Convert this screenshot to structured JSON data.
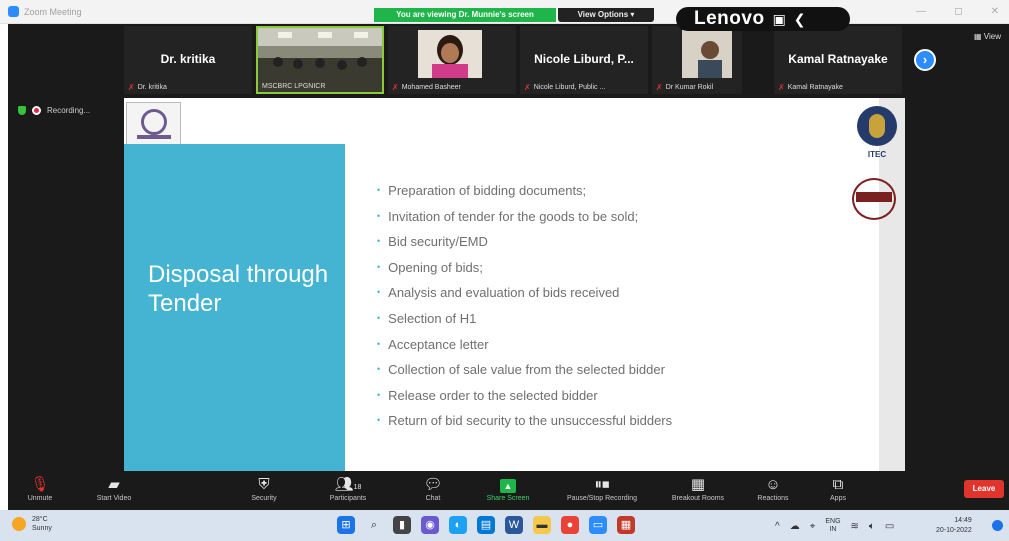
{
  "window": {
    "app_title": "Zoom Meeting",
    "viewing_banner": "You are viewing Dr. Munnie's screen",
    "view_options": "View Options",
    "lenovo_brand": "Lenovo",
    "view_button": "View"
  },
  "participants": [
    {
      "display_name": "Dr. kritika",
      "tag": "Dr. kritika",
      "has_video": false
    },
    {
      "display_name": "",
      "tag": "MSCBRC LPGNICR",
      "has_video": true,
      "active": true
    },
    {
      "display_name": "",
      "tag": "Mohamed Basheer",
      "has_video": true
    },
    {
      "display_name": "Nicole Liburd, P...",
      "tag": "Nicole Liburd, Public ...",
      "has_video": false
    },
    {
      "display_name": "",
      "tag": "Dr Kumar Rokil",
      "has_video": true
    },
    {
      "display_name": "Kamal Ratnayake",
      "tag": "Kamal Ratnayake",
      "has_video": false
    }
  ],
  "recording_label": "Recording...",
  "slide": {
    "title": "Disposal through Tender",
    "right_logo_text": "ITEC",
    "bullets": [
      "Preparation of bidding documents;",
      "Invitation of tender for the goods to be sold;",
      "Bid security/EMD",
      "Opening of bids;",
      "Analysis and evaluation of bids received",
      "Selection of H1",
      "Acceptance letter",
      "Collection of sale value from the selected bidder",
      "Release order to the selected bidder",
      "Return of bid security to the unsuccessful bidders"
    ],
    "panel_color": "#45b4d2"
  },
  "toolbar": {
    "unmute": "Unmute",
    "start_video": "Start Video",
    "security": "Security",
    "participants": "Participants",
    "participants_count": "18",
    "chat": "Chat",
    "share_screen": "Share Screen",
    "recording": "Pause/Stop Recording",
    "breakout": "Breakout Rooms",
    "reactions": "Reactions",
    "apps": "Apps",
    "leave": "Leave"
  },
  "taskbar": {
    "temperature": "28°C",
    "weather": "Sunny",
    "lang": "ENG",
    "lang_region": "IN",
    "time": "14:49",
    "date": "20-10-2022"
  }
}
